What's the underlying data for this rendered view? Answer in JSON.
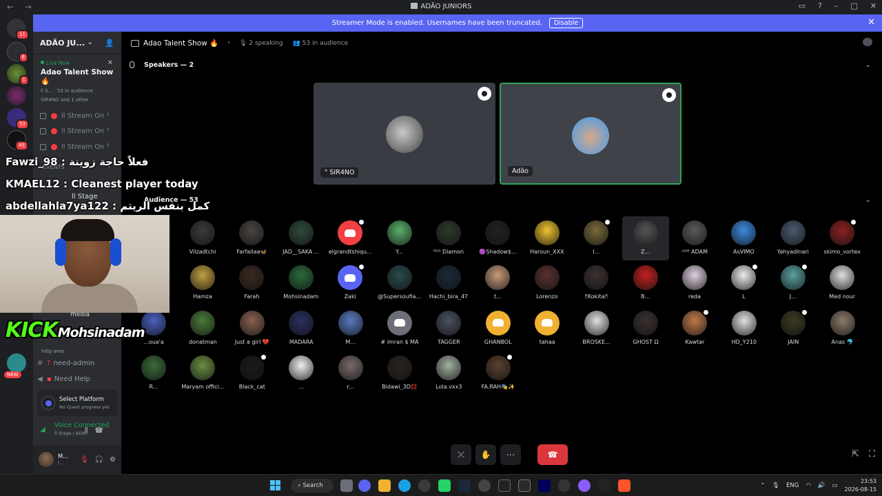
{
  "window": {
    "title": "ADÃO JUNIORS"
  },
  "banner": {
    "text": "Streamer Mode is enabled. Usernames have been truncated.",
    "disable_label": "Disable"
  },
  "guild_badges": [
    "11",
    "6",
    "1",
    "53",
    "45"
  ],
  "sidebar": {
    "server_name": "ADÃO JU...",
    "live_now": "Live Now",
    "live_title": "Adao Talent Show 🔥",
    "live_meta": "ll S...  · 53 in audience",
    "live_meta2": "SIR4NO and 1 other",
    "channels": [
      {
        "label": "ll Stream On ¹"
      },
      {
        "label": "ll Stream On ²"
      },
      {
        "label": "ll Stream On ³"
      }
    ],
    "events": "EVENTS",
    "stage_label": "ll Stage",
    "media_label": "media",
    "help_area": "help area",
    "need_admin": "need-admin",
    "need_help": "Need Help",
    "new_badge": "NEW"
  },
  "quest": {
    "title": "Select Platform",
    "subtitle": "No Quest progress yet"
  },
  "voice": {
    "status": "Voice Connected",
    "channel": "ll Stage / ADA..."
  },
  "user": {
    "name": "M...",
    "status": "l..."
  },
  "stage": {
    "title": "Adao Talent Show 🔥",
    "speaking": "2 speaking",
    "audience_count": "53 in audience",
    "speakers_header": "Speakers — 2",
    "audience_header": "Audience — 53",
    "speakers": [
      {
        "name": "\" SIR4NO"
      },
      {
        "name": "Adão"
      }
    ],
    "audience": [
      "Vilzadtchi",
      "Farfallaa🦋",
      "JAD__SAKA ...",
      "elgrandtshiqu...",
      "Y...",
      "ᴿᴱᴰ Diamon",
      "🟣Shadow$...",
      "Haroun_XXX",
      "I...",
      "Z...",
      "ᴬᴰᴹ ADAM",
      "AsVIMO",
      "Yahyadinari",
      "skimo_vortex",
      "Hamza",
      "Farah",
      "Mohsinadam",
      "Zaki",
      "@Supersoufia...",
      "Hachi_bira_47",
      "t...",
      "Lorenzo",
      "ᛗKokitaᛗ",
      "B...",
      "reda",
      "L",
      "J...",
      "Med nour",
      "...oua'a",
      "donatman",
      "Just a girl 💔",
      "MADARA",
      "M...",
      "# imran $ MA",
      "TAGGER",
      "GHANBOL",
      "tahaa",
      "BROSKE...",
      "GHOST Ω",
      "Kawtar",
      "HD_Y210",
      "JAIN",
      "Anas 🐬",
      "R...",
      "Maryam offici...",
      "Black_cat",
      "...",
      "r...",
      "Bidawi_3D💢",
      "Lola.vxx3",
      "FA.RAH🎭✨"
    ]
  },
  "overlay": {
    "msg1": "Fawzi_98 : فعلاً حاجة زوينة",
    "msg2": "KMAEL12 : Cleanest player today",
    "msg3": "abdellahla7ya122 : كمل بنفس الريتم",
    "kick_brand": "KICK",
    "kick_name": "Mohsinadam"
  },
  "taskbar": {
    "search": "Search",
    "lang": "ENG",
    "time": "23:53",
    "date": "2026-08-15"
  },
  "colors": {
    "accent": "#5865f2",
    "speaking": "#2fa45a",
    "danger": "#da373c"
  }
}
